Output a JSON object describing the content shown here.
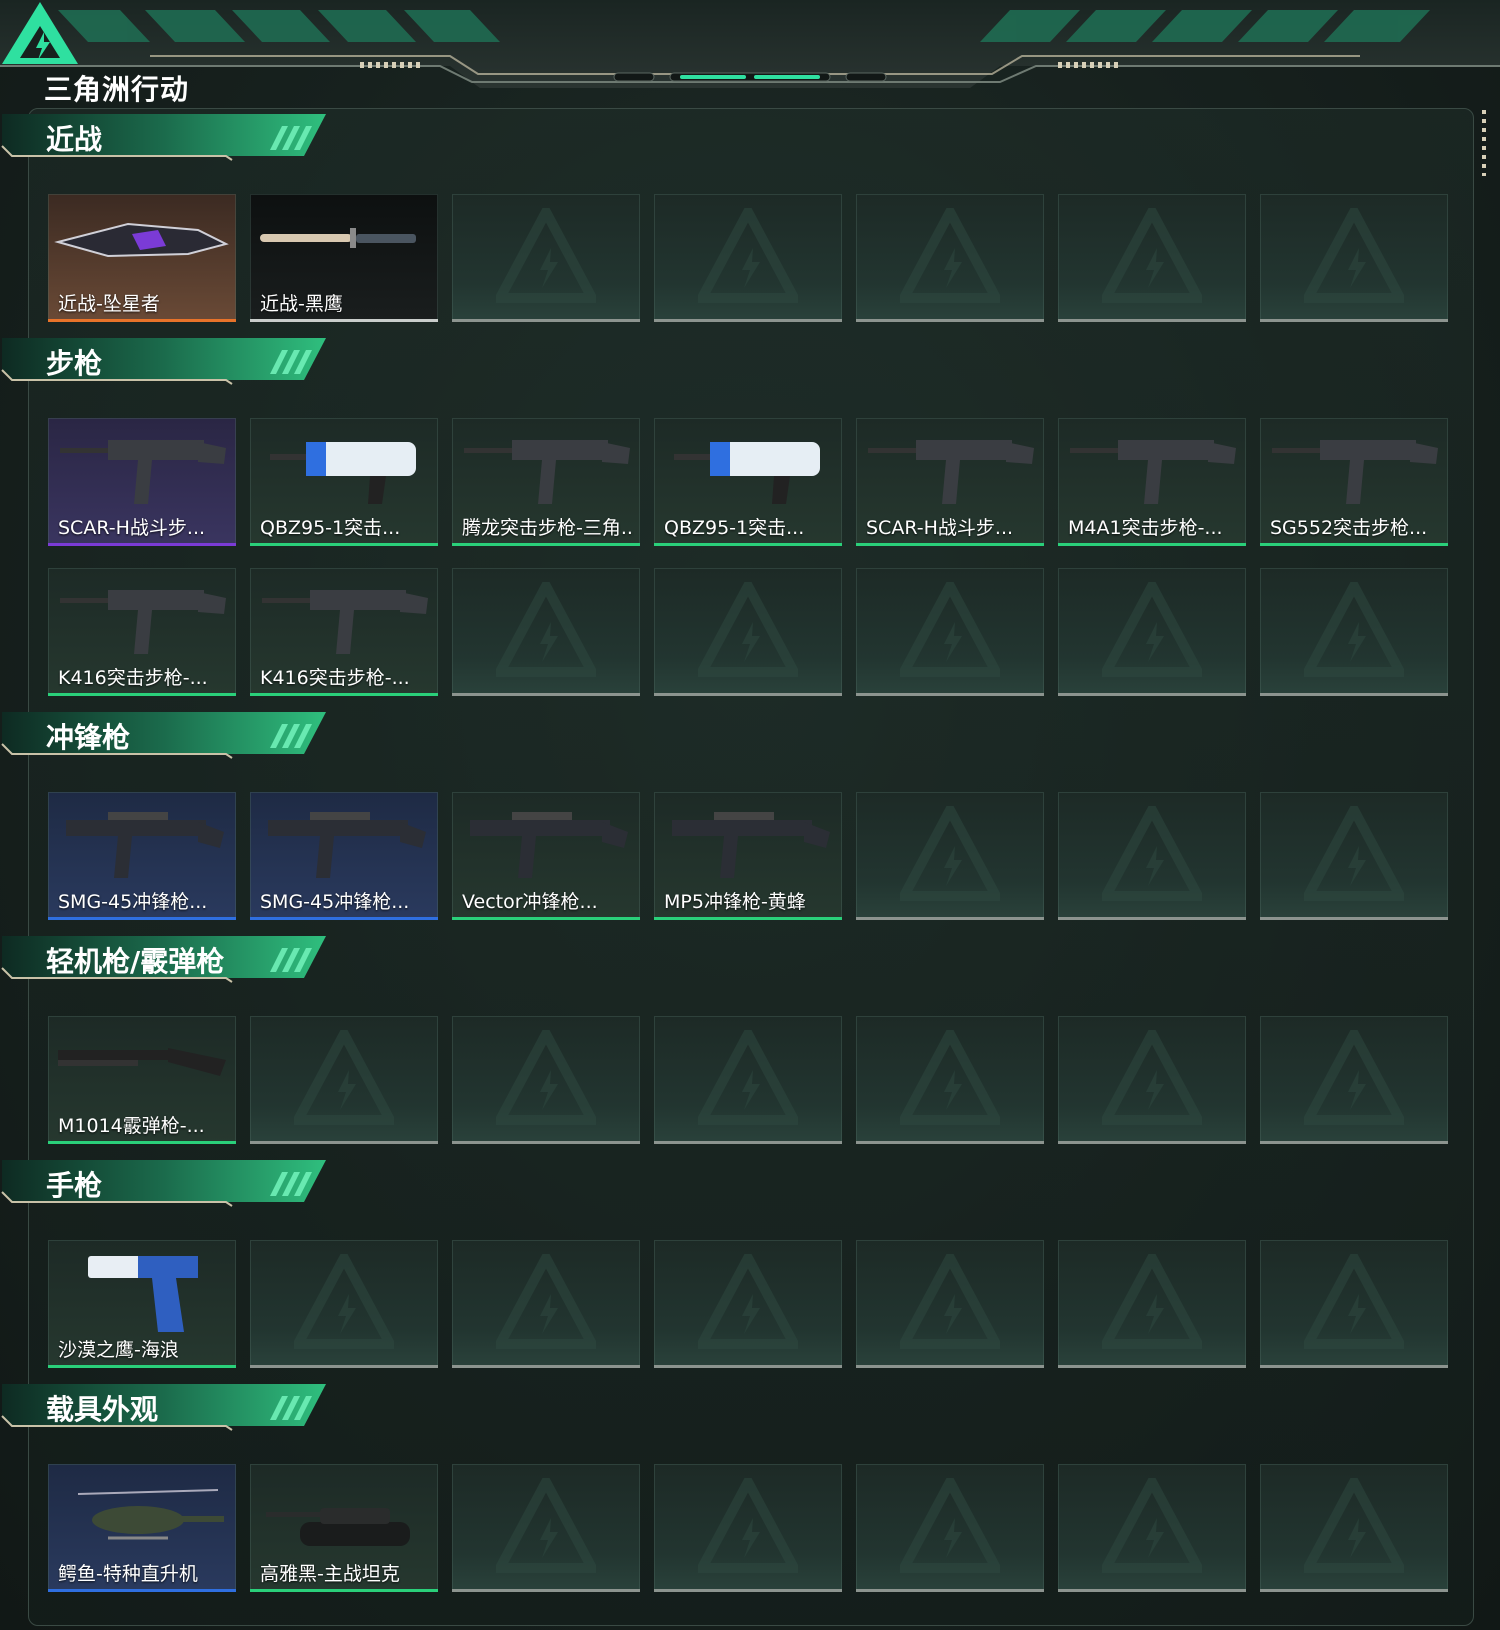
{
  "app": {
    "logo_text": "三角洲行动"
  },
  "colors": {
    "accent": "#2fe0a0",
    "rarity_orange": "#e8732a",
    "rarity_purple": "#7b3bd6",
    "rarity_green": "#2ad07a",
    "rarity_blue": "#2f6fe0",
    "empty_bar": "#8c948f"
  },
  "sections": [
    {
      "title": "近战",
      "items": [
        {
          "label": "近战-坠星者",
          "rarity": "orange",
          "icon": "melee-blade-icon"
        },
        {
          "label": "近战-黑鹰",
          "rarity": "white",
          "icon": "knife-icon"
        }
      ]
    },
    {
      "title": "步枪",
      "items": [
        {
          "label": "SCAR-H战斗步...",
          "rarity": "purple",
          "icon": "rifle-icon"
        },
        {
          "label": "QBZ95-1突击...",
          "rarity": "green",
          "icon": "bullpup-rifle-icon"
        },
        {
          "label": "腾龙突击步枪-三角...",
          "rarity": "green",
          "icon": "rifle-icon"
        },
        {
          "label": "QBZ95-1突击...",
          "rarity": "green",
          "icon": "bullpup-rifle-icon"
        },
        {
          "label": "SCAR-H战斗步...",
          "rarity": "green",
          "icon": "rifle-icon"
        },
        {
          "label": "M4A1突击步枪-...",
          "rarity": "green",
          "icon": "rifle-icon"
        },
        {
          "label": "SG552突击步枪...",
          "rarity": "green",
          "icon": "rifle-icon"
        },
        {
          "label": "K416突击步枪-...",
          "rarity": "green",
          "icon": "rifle-icon"
        },
        {
          "label": "K416突击步枪-...",
          "rarity": "green",
          "icon": "rifle-icon"
        }
      ]
    },
    {
      "title": "冲锋枪",
      "items": [
        {
          "label": "SMG-45冲锋枪...",
          "rarity": "blue",
          "icon": "smg-icon"
        },
        {
          "label": "SMG-45冲锋枪...",
          "rarity": "blue",
          "icon": "smg-icon"
        },
        {
          "label": "Vector冲锋枪...",
          "rarity": "green",
          "icon": "smg-icon"
        },
        {
          "label": "MP5冲锋枪-黄蜂",
          "rarity": "green",
          "icon": "smg-icon"
        }
      ]
    },
    {
      "title": "轻机枪/霰弹枪",
      "items": [
        {
          "label": "M1014霰弹枪-...",
          "rarity": "green",
          "icon": "shotgun-icon"
        }
      ]
    },
    {
      "title": "手枪",
      "items": [
        {
          "label": "沙漠之鹰-海浪",
          "rarity": "green",
          "icon": "pistol-icon"
        }
      ]
    },
    {
      "title": "载具外观",
      "items": [
        {
          "label": "鳄鱼-特种直升机",
          "rarity": "blue",
          "icon": "helicopter-icon"
        },
        {
          "label": "高雅黑-主战坦克",
          "rarity": "green",
          "icon": "tank-icon"
        }
      ]
    }
  ]
}
